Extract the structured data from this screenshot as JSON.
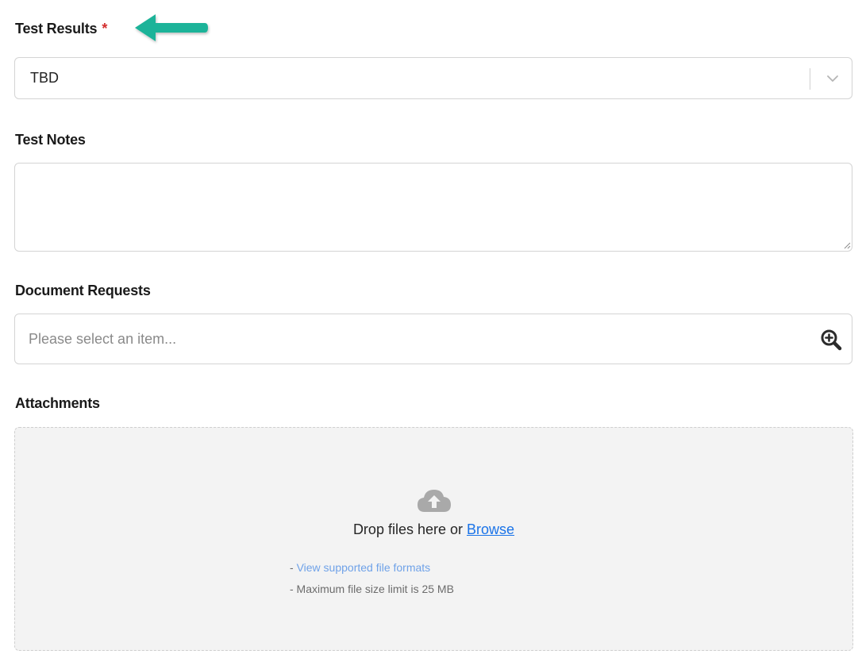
{
  "test_results": {
    "label": "Test Results",
    "required_mark": "*",
    "selected_value": "TBD"
  },
  "test_notes": {
    "label": "Test Notes",
    "value": ""
  },
  "document_requests": {
    "label": "Document Requests",
    "placeholder": "Please select an item..."
  },
  "attachments": {
    "label": "Attachments",
    "drop_text": "Drop files here or",
    "browse_label": "Browse",
    "formats_prefix": "- ",
    "formats_link": "View supported file formats",
    "size_limit": "- Maximum file size limit is 25 MB"
  },
  "icons": {
    "arrow": "arrow-left-icon",
    "chevron": "chevron-down-icon",
    "lookup": "zoom-in-icon",
    "upload": "cloud-upload-icon"
  },
  "colors": {
    "arrow": "#1fb399",
    "required": "#d32f2f",
    "link": "#1a73e8",
    "formats_link": "#6fa2e8"
  }
}
